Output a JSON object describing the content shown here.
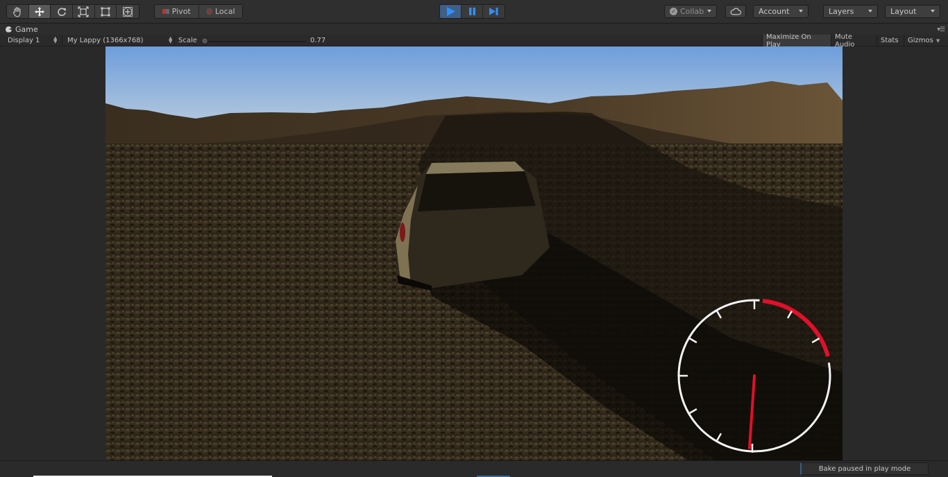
{
  "toolbar": {
    "tools": [
      "hand-tool",
      "move-tool",
      "rotate-tool",
      "scale-tool",
      "rect-tool",
      "transform-tool"
    ],
    "pivot_label": "Pivot",
    "local_label": "Local",
    "collab_label": "Collab",
    "account_label": "Account",
    "layers_label": "Layers",
    "layout_label": "Layout"
  },
  "game_window": {
    "tab_title": "Game",
    "display": "Display 1",
    "resolution": "My Lappy (1366x768)",
    "scale_label": "Scale",
    "scale_value": "0.77",
    "scale_fraction": 0.0,
    "maximize_on_play": "Maximize On Play",
    "mute_audio": "Mute Audio",
    "stats": "Stats",
    "gizmos": "Gizmos"
  },
  "speedometer": {
    "needle_fraction": 0.02,
    "redline_start_fraction": 0.72,
    "needle_color": "#e0102a",
    "redline_color": "#e0102a"
  },
  "status": {
    "bake_message": "Bake paused in play mode"
  },
  "colors": {
    "play_active": "#3f5f86",
    "sky_top": "#6f9fd8",
    "accent_blue": "#3c6b9c"
  }
}
